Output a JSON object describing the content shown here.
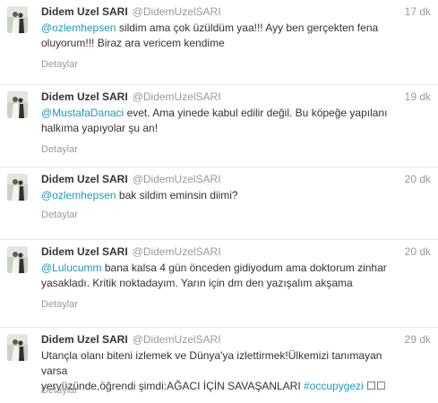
{
  "tweets": [
    {
      "name": "Didem Uzel SARI",
      "handle": "@DidemUzelSARI",
      "time": "17 dk",
      "mention": "@ozlemhepsen",
      "text_after_mention": " sildim ama çok üzüldüm yaa!!! Ayy ben gerçekten fena",
      "line2": "oluyorum!!! Biraz ara vericem kendime",
      "details": "Detaylar"
    },
    {
      "name": "Didem Uzel SARI",
      "handle": "@DidemUzelSARI",
      "time": "19 dk",
      "mention": "@MustafaDanaci",
      "text_after_mention": " evet. Ama yinede kabul edilir değil. Bu köpeğe yapılanı",
      "line2": "halkıma yapıyolar şu an!",
      "details": "Detaylar"
    },
    {
      "name": "Didem Uzel SARI",
      "handle": "@DidemUzelSARI",
      "time": "20 dk",
      "mention": "@ozlemhepsen",
      "text_after_mention": " bak sildim eminsin diimi?",
      "details": "Detaylar"
    },
    {
      "name": "Didem Uzel SARI",
      "handle": "@DidemUzelSARI",
      "time": "20 dk",
      "mention": "@Lulucumm",
      "text_after_mention": " bana kalsa 4 gün önceden gidiyodum ama doktorum zinhar",
      "line2": "yasakladı. Kritik noktadayım. Yarın için dm den yazışalım akşama",
      "details": "Detaylar"
    },
    {
      "name": "Didem Uzel SARI",
      "handle": "@DidemUzelSARI",
      "time": "29 dk",
      "line1": "Utançla olanı biteni izlemek ve Dünya'ya izlettirmek!Ülkemizi tanımayan varsa",
      "line2_before_hashtag": "yeryüzünde,öğrendi şimdi:AĞACI İÇİN SAVAŞANLARI ",
      "hashtag": "#occupygezi",
      "line2_after_hashtag": " ☐☐",
      "details": "Detaylar"
    }
  ]
}
